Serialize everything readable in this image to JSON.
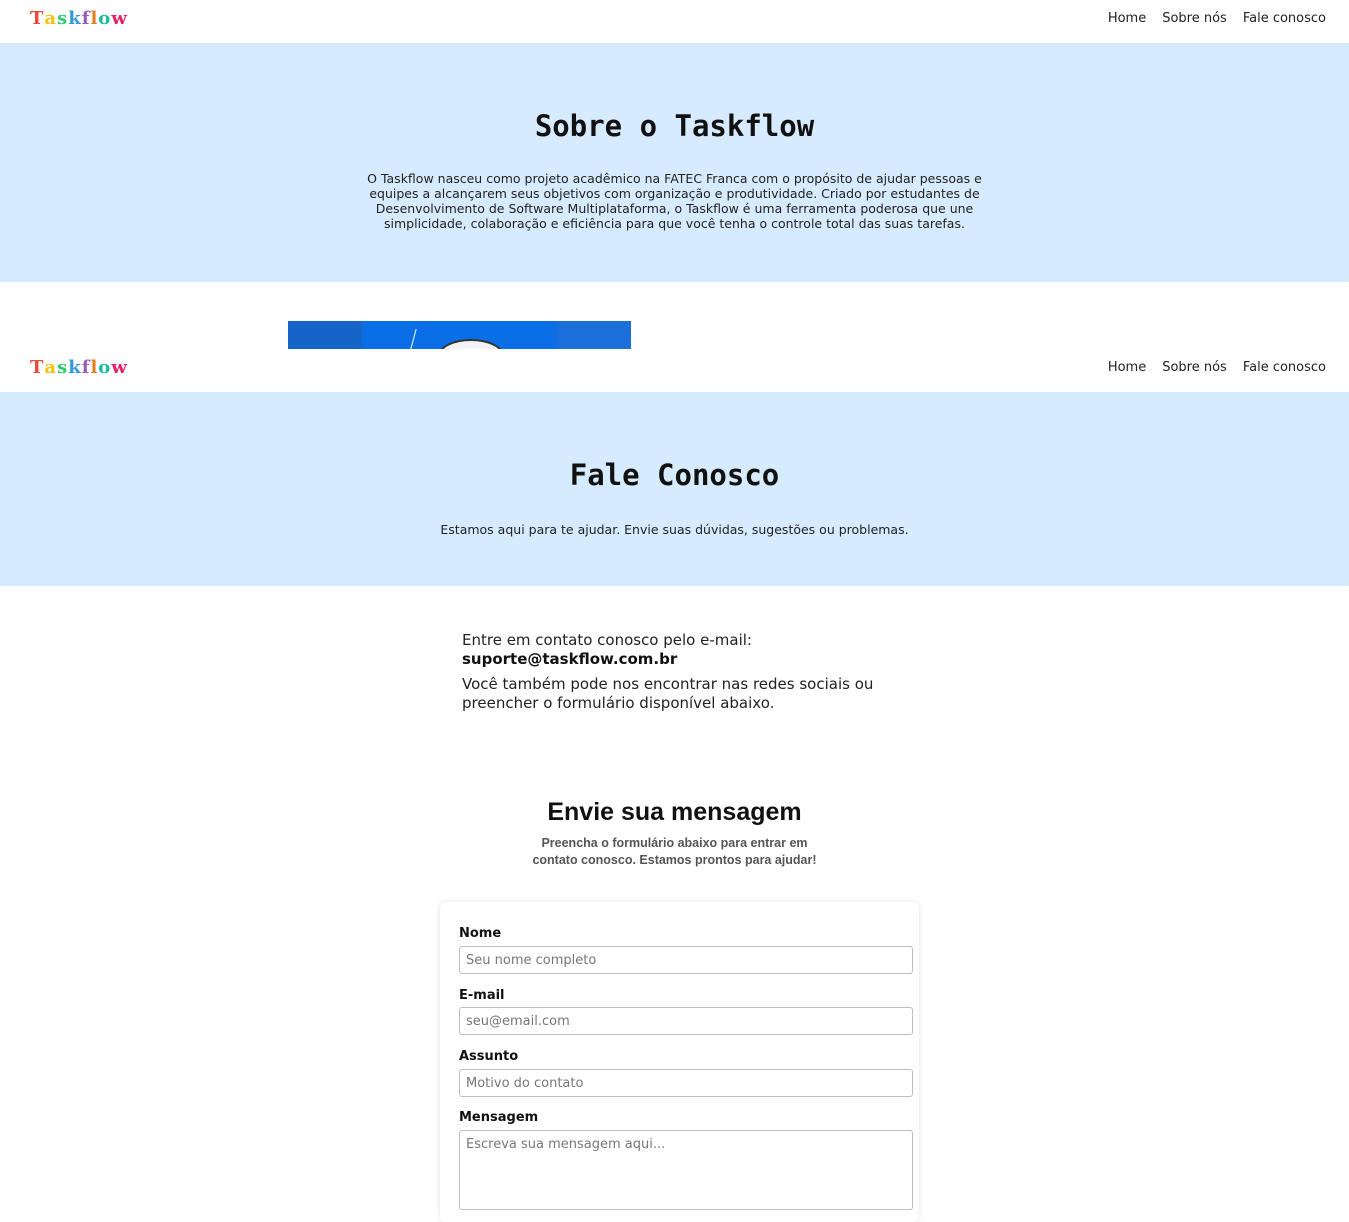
{
  "logo": {
    "text": "Taskflow",
    "letter_colors": [
      "#e74c3c",
      "#f1c40f",
      "#2ecc71",
      "#3498db",
      "#9b59b6",
      "#e67e22",
      "#1abc9c",
      "#e91e63"
    ]
  },
  "nav": {
    "links": [
      "Home",
      "Sobre nós",
      "Fale conosco"
    ]
  },
  "about": {
    "title": "Sobre o Taskflow",
    "text": "O Taskflow nasceu como projeto acadêmico na FATEC Franca com o propósito de ajudar pessoas e equipes a alcançarem seus objetivos com organização e produtividade. Criado por estudantes de Desenvolvimento de Software Multiplataforma, o Taskflow é uma ferramenta poderosa que une simplicidade, colaboração e eficiência para que você tenha o controle total das suas tarefas."
  },
  "contact_hero": {
    "title": "Fale Conosco",
    "text": "Estamos aqui para te ajudar. Envie suas dúvidas, sugestões ou problemas."
  },
  "contact_info": {
    "intro": "Entre em contato conosco pelo e-mail:",
    "email": "suporte@taskflow.com.br",
    "extra": "Você também pode nos encontrar nas redes sociais ou preencher o formulário disponível abaixo."
  },
  "form": {
    "title": "Envie sua mensagem",
    "subtitle": "Preencha o formulário abaixo para entrar em contato conosco. Estamos prontos para ajudar!",
    "fields": [
      {
        "label": "Nome",
        "placeholder": "Seu nome completo"
      },
      {
        "label": "E-mail",
        "placeholder": "seu@email.com"
      },
      {
        "label": "Assunto",
        "placeholder": "Motivo do contato"
      },
      {
        "label": "Mensagem",
        "placeholder": "Escreva sua mensagem aqui..."
      }
    ]
  },
  "colors": {
    "hero_bg": "#d6ebfd"
  }
}
